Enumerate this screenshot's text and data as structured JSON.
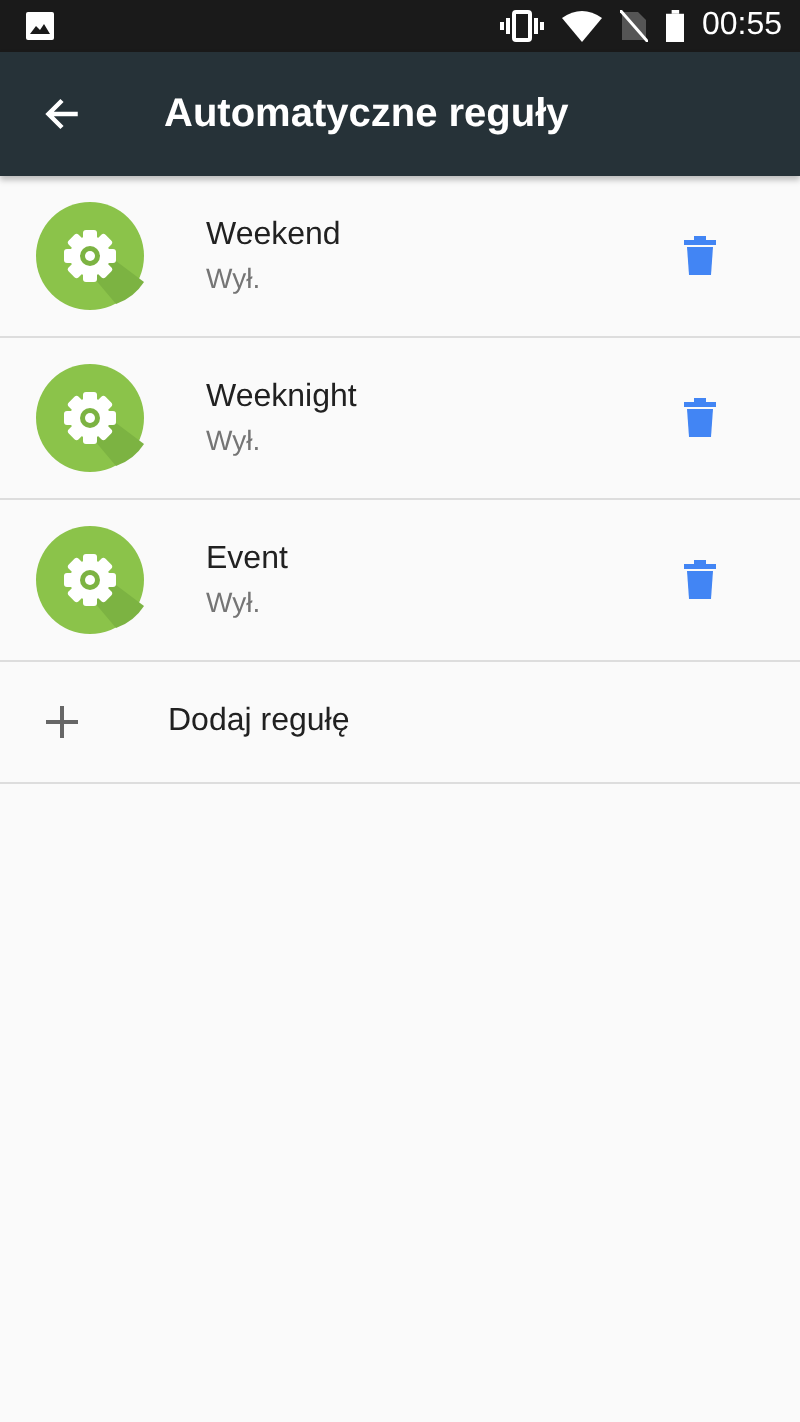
{
  "status_bar": {
    "time": "00:55"
  },
  "toolbar": {
    "title": "Automatyczne reguły"
  },
  "rules": [
    {
      "name": "Weekend",
      "status": "Wył."
    },
    {
      "name": "Weeknight",
      "status": "Wył."
    },
    {
      "name": "Event",
      "status": "Wył."
    }
  ],
  "add_rule": {
    "label": "Dodaj regułę"
  }
}
